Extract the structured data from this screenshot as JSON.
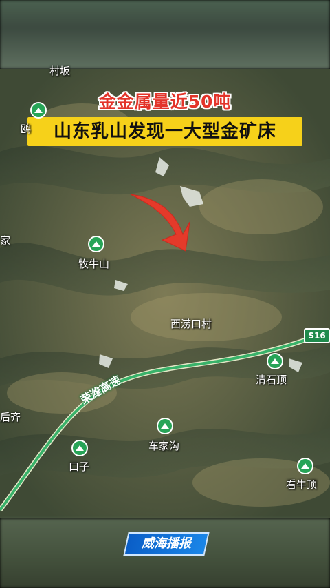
{
  "headline": {
    "line1": "金金属量近50吨",
    "line2": "山东乳山发现一大型金矿床"
  },
  "map": {
    "labels": {
      "muniushan": "牧牛山",
      "xilaokoucun": "西涝口村",
      "qingshiding": "清石顶",
      "chejiagou": "车家沟",
      "houjie": "后齐",
      "kouzi": "口子",
      "kanniuding": "看牛顶",
      "edge_left": "家",
      "edge_topleft": "鸥",
      "top_partial": "村坂"
    },
    "highway": {
      "name": "荣潍高速",
      "shield": "S16",
      "color": "#39b26a"
    },
    "arrow_color": "#e53a2a",
    "poi_icon": "mountain-peak-icon"
  },
  "brand": {
    "name": "威海播报"
  }
}
